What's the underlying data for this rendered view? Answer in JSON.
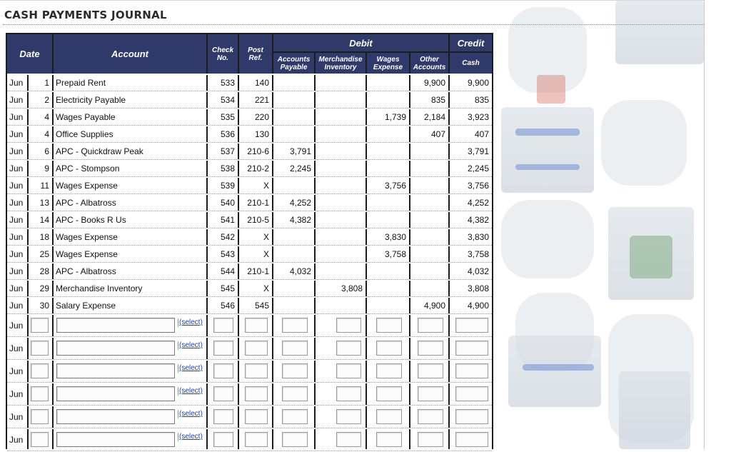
{
  "title": "CASH PAYMENTS JOURNAL",
  "headers": {
    "date": "Date",
    "account": "Account",
    "check_line1": "Check",
    "check_line2": "No.",
    "post_line1": "Post",
    "post_line2": "Ref.",
    "debit": "Debit",
    "credit": "Credit",
    "ap_line1": "Accounts",
    "ap_line2": "Payable",
    "mi_line1": "Merchandise",
    "mi_line2": "Inventory",
    "we_line1": "Wages",
    "we_line2": "Expense",
    "oa_line1": "Other",
    "oa_line2": "Accounts",
    "cash": "Cash"
  },
  "rows": [
    {
      "month": "Jun",
      "day": "1",
      "account": "Prepaid Rent",
      "check": "533",
      "post": "140",
      "ap": "",
      "mi": "",
      "we": "",
      "oa": "9,900",
      "cash": "9,900"
    },
    {
      "month": "Jun",
      "day": "2",
      "account": "Electricity Payable",
      "check": "534",
      "post": "221",
      "ap": "",
      "mi": "",
      "we": "",
      "oa": "835",
      "cash": "835"
    },
    {
      "month": "Jun",
      "day": "4",
      "account": "Wages Payable",
      "check": "535",
      "post": "220",
      "ap": "",
      "mi": "",
      "we": "1,739",
      "oa": "2,184",
      "cash": "3,923"
    },
    {
      "month": "Jun",
      "day": "4",
      "account": "Office Supplies",
      "check": "536",
      "post": "130",
      "ap": "",
      "mi": "",
      "we": "",
      "oa": "407",
      "cash": "407"
    },
    {
      "month": "Jun",
      "day": "6",
      "account": "APC - Quickdraw Peak",
      "check": "537",
      "post": "210-6",
      "ap": "3,791",
      "mi": "",
      "we": "",
      "oa": "",
      "cash": "3,791"
    },
    {
      "month": "Jun",
      "day": "9",
      "account": "APC - Stompson",
      "check": "538",
      "post": "210-2",
      "ap": "2,245",
      "mi": "",
      "we": "",
      "oa": "",
      "cash": "2,245"
    },
    {
      "month": "Jun",
      "day": "11",
      "account": "Wages Expense",
      "check": "539",
      "post": "X",
      "ap": "",
      "mi": "",
      "we": "3,756",
      "oa": "",
      "cash": "3,756"
    },
    {
      "month": "Jun",
      "day": "13",
      "account": "APC - Albatross",
      "check": "540",
      "post": "210-1",
      "ap": "4,252",
      "mi": "",
      "we": "",
      "oa": "",
      "cash": "4,252"
    },
    {
      "month": "Jun",
      "day": "14",
      "account": "APC - Books R Us",
      "check": "541",
      "post": "210-5",
      "ap": "4,382",
      "mi": "",
      "we": "",
      "oa": "",
      "cash": "4,382"
    },
    {
      "month": "Jun",
      "day": "18",
      "account": "Wages Expense",
      "check": "542",
      "post": "X",
      "ap": "",
      "mi": "",
      "we": "3,830",
      "oa": "",
      "cash": "3,830"
    },
    {
      "month": "Jun",
      "day": "25",
      "account": "Wages Expense",
      "check": "543",
      "post": "X",
      "ap": "",
      "mi": "",
      "we": "3,758",
      "oa": "",
      "cash": "3,758"
    },
    {
      "month": "Jun",
      "day": "28",
      "account": "APC - Albatross",
      "check": "544",
      "post": "210-1",
      "ap": "4,032",
      "mi": "",
      "we": "",
      "oa": "",
      "cash": "4,032"
    },
    {
      "month": "Jun",
      "day": "29",
      "account": "Merchandise Inventory",
      "check": "545",
      "post": "X",
      "ap": "",
      "mi": "3,808",
      "we": "",
      "oa": "",
      "cash": "3,808"
    },
    {
      "month": "Jun",
      "day": "30",
      "account": "Salary Expense",
      "check": "546",
      "post": "545",
      "ap": "",
      "mi": "",
      "we": "",
      "oa": "4,900",
      "cash": "4,900"
    }
  ],
  "input_rows": [
    {
      "month": "Jun",
      "select_label": "(select)"
    },
    {
      "month": "Jun",
      "select_label": "(select)"
    },
    {
      "month": "Jun",
      "select_label": "(select)"
    },
    {
      "month": "Jun",
      "select_label": "(select)"
    },
    {
      "month": "Jun",
      "select_label": "(select)"
    },
    {
      "month": "Jun",
      "select_label": "(select)"
    }
  ]
}
